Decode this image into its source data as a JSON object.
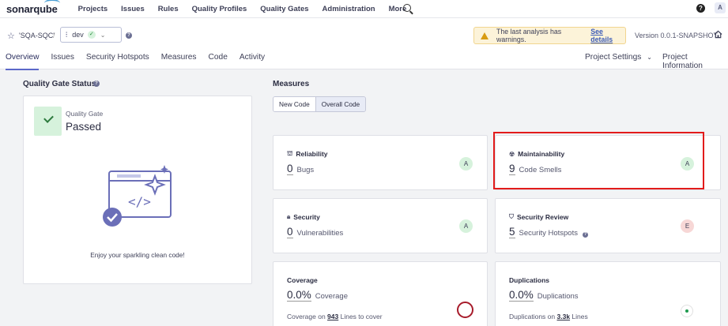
{
  "app": {
    "logo": "sonarqube",
    "user_initial": "A"
  },
  "topnav": {
    "items": [
      "Projects",
      "Issues",
      "Rules",
      "Quality Profiles",
      "Quality Gates",
      "Administration",
      "More"
    ]
  },
  "project": {
    "name": "'SQA-SQC'",
    "separator": "/",
    "branch": "dev",
    "warning_text": "The last analysis has warnings.",
    "warning_link": "See details",
    "version": "Version 0.0.1-SNAPSHOT"
  },
  "tabs": [
    "Overview",
    "Issues",
    "Security Hotspots",
    "Measures",
    "Code",
    "Activity"
  ],
  "tabs_right": {
    "settings": "Project Settings",
    "settings_chevron": "⌄",
    "info": "Project Information"
  },
  "quality_gate": {
    "section_title": "Quality Gate Status",
    "label": "Quality Gate",
    "status": "Passed",
    "message": "Enjoy your sparkling clean code!"
  },
  "measures": {
    "section_title": "Measures",
    "toggle": [
      "New Code",
      "Overall Code"
    ],
    "reliability": {
      "title": "Reliability",
      "value": "0",
      "unit": "Bugs",
      "rating": "A"
    },
    "maintainability": {
      "title": "Maintainability",
      "value": "9",
      "unit": "Code Smells",
      "rating": "A"
    },
    "security": {
      "title": "Security",
      "value": "0",
      "unit": "Vulnerabilities",
      "rating": "A"
    },
    "security_review": {
      "title": "Security Review",
      "value": "5",
      "unit": "Security Hotspots",
      "rating": "E"
    },
    "coverage": {
      "title": "Coverage",
      "value": "0.0%",
      "unit": "Coverage",
      "line_prefix": "Coverage on",
      "line_count": "943",
      "line_suffix": "Lines to cover"
    },
    "duplications": {
      "title": "Duplications",
      "value": "0.0%",
      "unit": "Duplications",
      "line_prefix": "Duplications on",
      "line_count": "3.3k",
      "line_suffix": "Lines"
    }
  },
  "colors": {
    "accent": "#5b68c9",
    "passed_bg": "#d6f2dc",
    "rating_a": "#d6f2dc",
    "rating_e": "#f7d7d6",
    "highlight": "#e21b1b"
  }
}
